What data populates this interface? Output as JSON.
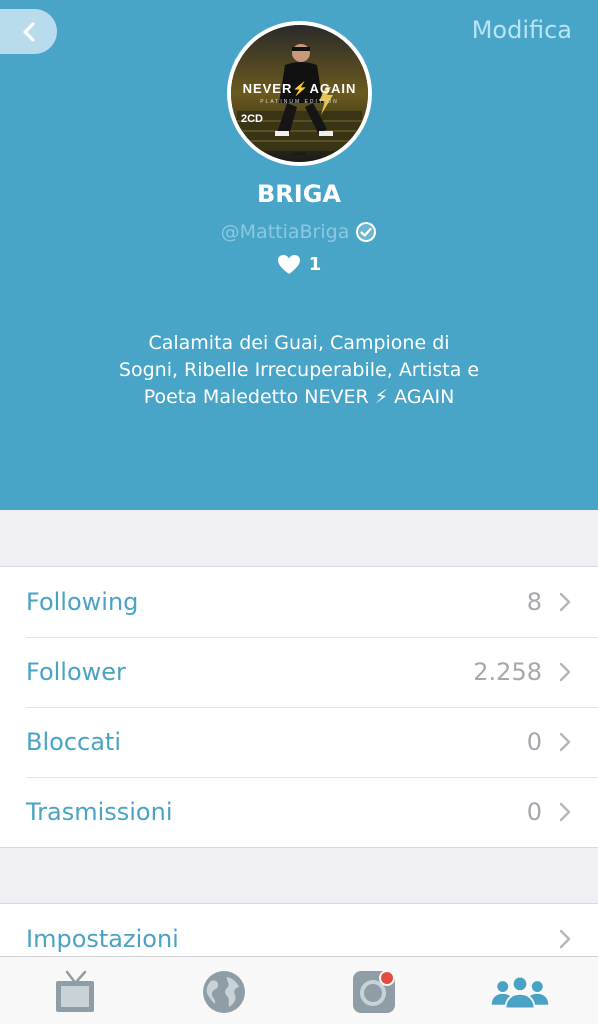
{
  "nav": {
    "edit_label": "Modifica"
  },
  "cover": {
    "title_left": "NEVER",
    "title_right": "AGAIN",
    "subtitle": "PLATINUM EDITION",
    "badge": "2CD",
    "logo": "BRIGA"
  },
  "profile": {
    "name": "BRIGA",
    "handle": "@MattiaBriga",
    "likes": "1",
    "bio_lines": [
      "Calamita dei Guai, Campione di",
      "Sogni, Ribelle Irrecuperabile, Artista e",
      "Poeta Maledetto NEVER ⚡ AGAIN"
    ]
  },
  "stats": [
    {
      "label": "Following",
      "value": "8"
    },
    {
      "label": "Follower",
      "value": "2.258"
    },
    {
      "label": "Bloccati",
      "value": "0"
    },
    {
      "label": "Trasmissioni",
      "value": "0"
    }
  ],
  "settings": {
    "label": "Impostazioni"
  },
  "tabbar": {
    "icons": [
      "tv-icon",
      "globe-icon",
      "camera-broadcast-icon",
      "people-icon"
    ],
    "active_color": "#4aa3c5",
    "inactive_color": "#8f9ea6"
  },
  "colors": {
    "header_bg": "#48a5c8",
    "accent": "#4aa3c5",
    "background": "#efeff4"
  }
}
